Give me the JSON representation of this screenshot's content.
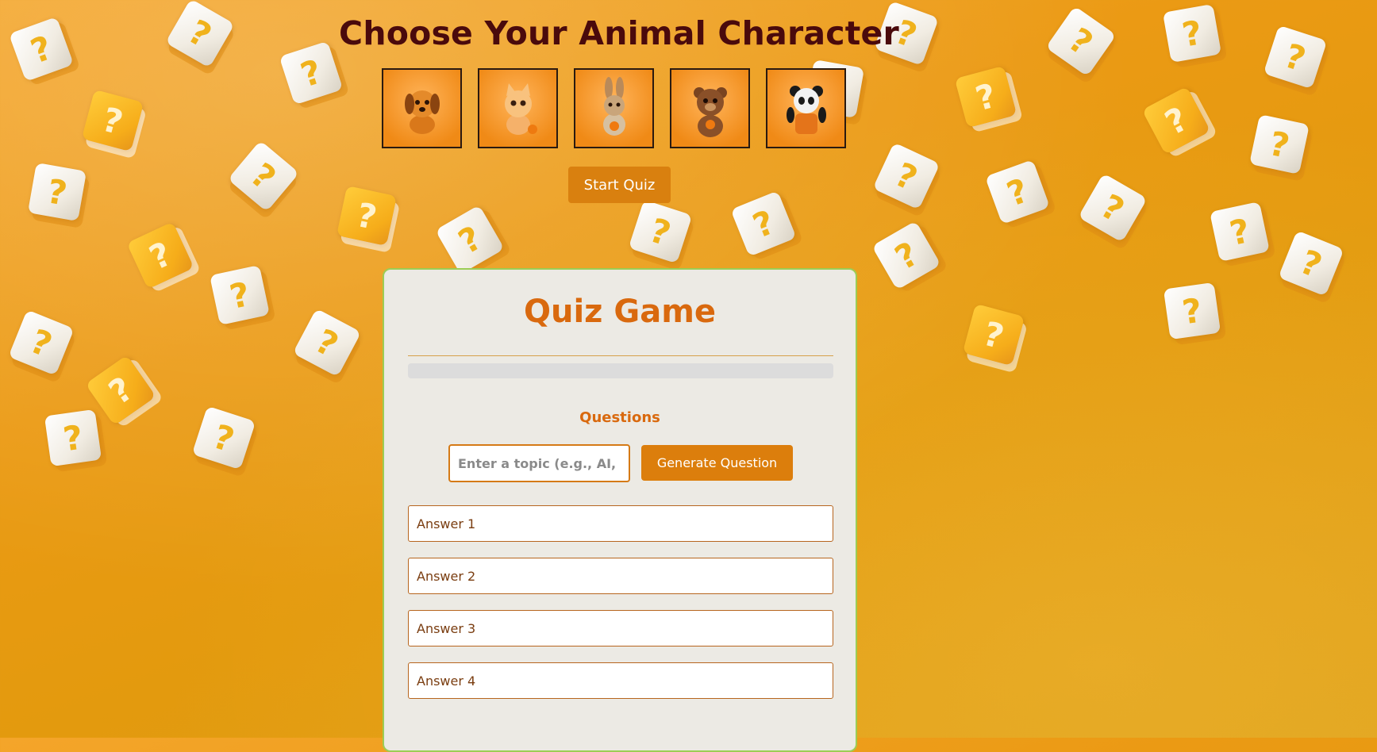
{
  "header": {
    "title": "Choose Your Animal Character"
  },
  "characters": [
    {
      "name": "dog",
      "icon": "dog-icon"
    },
    {
      "name": "cat",
      "icon": "cat-icon"
    },
    {
      "name": "rabbit",
      "icon": "rabbit-icon"
    },
    {
      "name": "bear",
      "icon": "bear-icon"
    },
    {
      "name": "panda",
      "icon": "panda-icon"
    }
  ],
  "start_button": {
    "label": "Start Quiz"
  },
  "quiz": {
    "title": "Quiz Game",
    "progress": 0,
    "questions_label": "Questions",
    "topic_placeholder": "Enter a topic (e.g., AI, History)",
    "generate_label": "Generate Question",
    "answers": [
      "Answer 1",
      "Answer 2",
      "Answer 3",
      "Answer 4"
    ]
  },
  "colors": {
    "title": "#4a0a0c",
    "accent": "#d9690e",
    "button": "#d9800f",
    "card_border": "#9ccd55"
  }
}
